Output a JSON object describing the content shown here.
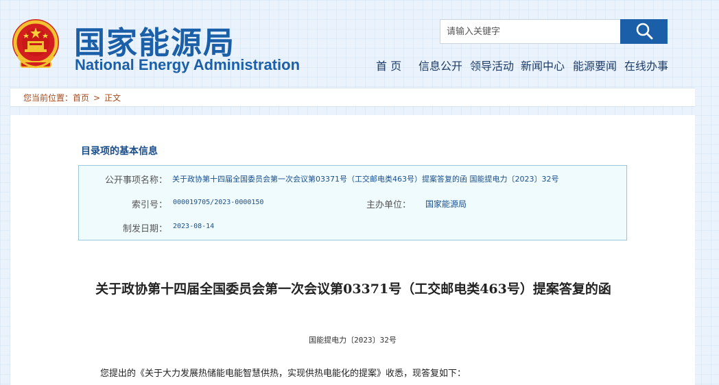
{
  "header": {
    "title_cn": "国家能源局",
    "title_en": "National Energy Administration",
    "emblem_icon": "national-emblem-icon"
  },
  "search": {
    "placeholder": "请输入关键字",
    "button_icon": "search-icon"
  },
  "nav": {
    "items": [
      "首 页",
      "信息公开",
      "领导活动",
      "新闻中心",
      "能源要闻",
      "在线办事"
    ]
  },
  "breadcrumb": {
    "prefix": "您当前位置：",
    "home": "首页",
    "separator": ">",
    "current": "正文"
  },
  "meta": {
    "heading": "目录项的基本信息",
    "name_label": "公开事项名称：",
    "name_value": "关于政协第十四届全国委员会第一次会议第03371号（工交邮电类463号）提案答复的函 国能提电力〔2023〕32号",
    "index_label": "索引号：",
    "index_value": "000019705/2023-0000150",
    "org_label": "主办单位：",
    "org_value": "国家能源局",
    "date_label": "制发日期：",
    "date_value": "2023-08-14"
  },
  "document": {
    "title": "关于政协第十四届全国委员会第一次会议第03371号（工交邮电类463号）提案答复的函",
    "number": "国能提电力〔2023〕32号",
    "body_first_line": "您提出的《关于大力发展热储能电能智慧供热，实现供热电能化的提案》收悉，现答复如下："
  },
  "colors": {
    "brand_blue": "#1a5fa8",
    "breadcrumb_text": "#a44a1c",
    "meta_box_bg": "#f0fbfe"
  }
}
